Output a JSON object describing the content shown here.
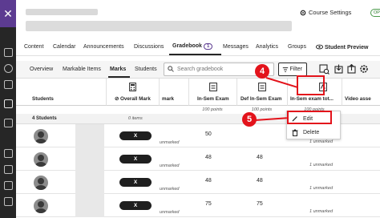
{
  "header": {
    "course_settings_label": "Course Settings",
    "status_badge": "OPEN"
  },
  "nav_tabs": [
    {
      "label": "Content"
    },
    {
      "label": "Calendar"
    },
    {
      "label": "Announcements"
    },
    {
      "label": "Discussions"
    },
    {
      "label": "Gradebook",
      "badge": "1"
    },
    {
      "label": "Messages"
    },
    {
      "label": "Analytics"
    },
    {
      "label": "Groups"
    },
    {
      "label": "Student Preview"
    }
  ],
  "sub_tabs": [
    {
      "label": "Overview"
    },
    {
      "label": "Markable Items"
    },
    {
      "label": "Marks"
    },
    {
      "label": "Students"
    }
  ],
  "search": {
    "placeholder": "Search gradebook"
  },
  "filter_label": "Filter",
  "columns": {
    "students": "Students",
    "overall": "Overall Mark",
    "mark_partial": "mark",
    "in_sem": "In-Sem Exam",
    "def_in_sem": "Def In-Sem Exam",
    "in_sem_total": "In-Sem exam tot...",
    "video": "Video asse"
  },
  "points": {
    "in_sem": "100 points",
    "def_in_sem": "100 points",
    "in_sem_total": "100 points"
  },
  "summary": {
    "students_count": "4 Students",
    "overall_items": "0 items"
  },
  "rows": [
    {
      "pill": "X",
      "in_sem": "50",
      "total_status": "1 unmarked",
      "mark_status": "unmarked"
    },
    {
      "pill": "X",
      "in_sem": "48",
      "def_in_sem": "48",
      "total_status": "1 unmarked",
      "mark_status": "unmarked"
    },
    {
      "pill": "X",
      "in_sem": "48",
      "def_in_sem": "48",
      "total_status": "1 unmarked",
      "mark_status": "unmarked"
    },
    {
      "pill": "X",
      "in_sem": "75",
      "def_in_sem": "75",
      "total_status": "1 unmarked",
      "mark_status": "unmarked"
    }
  ],
  "context_menu": {
    "edit": "Edit",
    "delete": "Delete"
  },
  "steps": {
    "step4": "4",
    "step5": "5"
  },
  "colors": {
    "accent": "#5c3b91",
    "highlight": "#e3131b",
    "dark": "#262626"
  }
}
